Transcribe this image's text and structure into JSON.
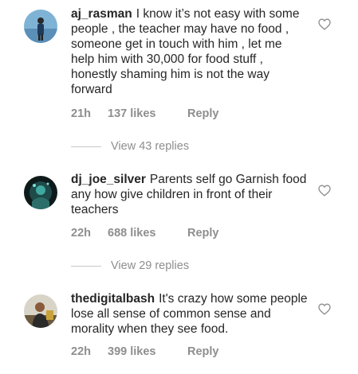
{
  "comments": [
    {
      "username": "aj_rasman",
      "text": "I know it’s not easy with some people , the teacher may have no food , someone get in touch with him , let me help him with 30,000 for food stuff , honestly shaming him is not the way forward",
      "time": "21h",
      "likes": "137 likes",
      "reply": "Reply",
      "view_replies": "View 43 replies",
      "avatar_icon": "avatar-person-icon"
    },
    {
      "username": "dj_joe_silver",
      "text": "Parents self go Garnish food any how give children in front of their teachers",
      "time": "22h",
      "likes": "688 likes",
      "reply": "Reply",
      "view_replies": "View 29 replies",
      "avatar_icon": "avatar-dj-icon"
    },
    {
      "username": "thedigitalbash",
      "text": "It's crazy how some people lose all sense of common sense and morality when they see food.",
      "time": "22h",
      "likes": "399 likes",
      "reply": "Reply",
      "avatar_icon": "avatar-photo-icon"
    }
  ],
  "colors": {
    "text": "#262626",
    "secondary": "#8e8e8e",
    "divider": "#c7c7c7"
  }
}
